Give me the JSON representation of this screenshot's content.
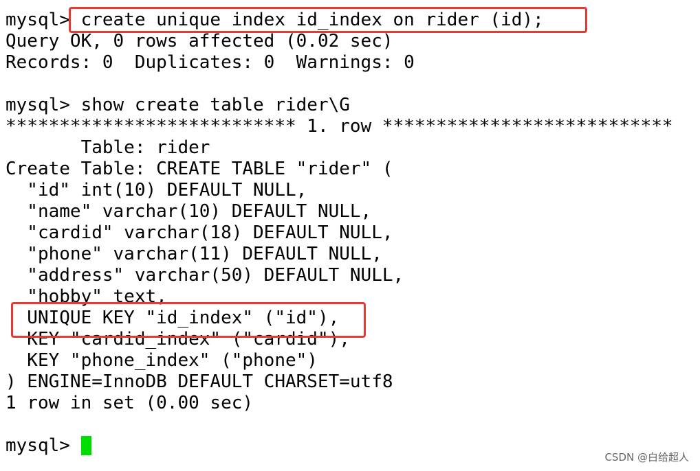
{
  "terminal": {
    "lines": [
      "mysql> create unique index id_index on rider (id);",
      "Query OK, 0 rows affected (0.02 sec)",
      "Records: 0  Duplicates: 0  Warnings: 0",
      "",
      "mysql> show create table rider\\G",
      "*************************** 1. row ***************************",
      "       Table: rider",
      "Create Table: CREATE TABLE \"rider\" (",
      "  \"id\" int(10) DEFAULT NULL,",
      "  \"name\" varchar(10) DEFAULT NULL,",
      "  \"cardid\" varchar(18) DEFAULT NULL,",
      "  \"phone\" varchar(11) DEFAULT NULL,",
      "  \"address\" varchar(50) DEFAULT NULL,",
      "  \"hobby\" text,",
      "  UNIQUE KEY \"id_index\" (\"id\"),",
      "  KEY \"cardid_index\" (\"cardid\"),",
      "  KEY \"phone_index\" (\"phone\")",
      ") ENGINE=InnoDB DEFAULT CHARSET=utf8",
      "1 row in set (0.00 sec)",
      ""
    ],
    "prompt": "mysql> "
  },
  "watermark": "CSDN @白给超人",
  "colors": {
    "background": "#ffffff",
    "text": "#000000",
    "cursor": "#00dd00",
    "highlight": "#e53935"
  }
}
